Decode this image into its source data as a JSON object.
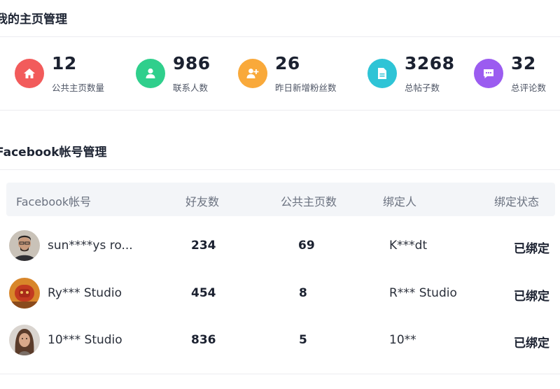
{
  "sections": {
    "home_title": "我的主页管理",
    "fb_title": "Facebook帐号管理"
  },
  "stats": [
    {
      "value": "12",
      "label": "公共主页数量",
      "icon": "home-icon",
      "color": "#f25b5b"
    },
    {
      "value": "986",
      "label": "联系人数",
      "icon": "user-icon",
      "color": "#2fcf8c"
    },
    {
      "value": "26",
      "label": "昨日新增粉丝数",
      "icon": "add-user-icon",
      "color": "#f9a93a"
    },
    {
      "value": "3268",
      "label": "总帖子数",
      "icon": "document-icon",
      "color": "#2ec4d6"
    },
    {
      "value": "32",
      "label": "总评论数",
      "icon": "comment-icon",
      "color": "#9b5cf0"
    }
  ],
  "table": {
    "headers": [
      "Facebook帐号",
      "好友数",
      "公共主页数",
      "绑定人",
      "绑定状态"
    ],
    "rows": [
      {
        "account": "sun****ys ro...",
        "friends": "234",
        "pages": "69",
        "binder": "K***dt",
        "status": "已绑定"
      },
      {
        "account": "Ry*** Studio",
        "friends": "454",
        "pages": "8",
        "binder": "R*** Studio",
        "status": "已绑定"
      },
      {
        "account": "10***  Studio",
        "friends": "836",
        "pages": "5",
        "binder": "10**",
        "status": "已绑定"
      }
    ]
  }
}
